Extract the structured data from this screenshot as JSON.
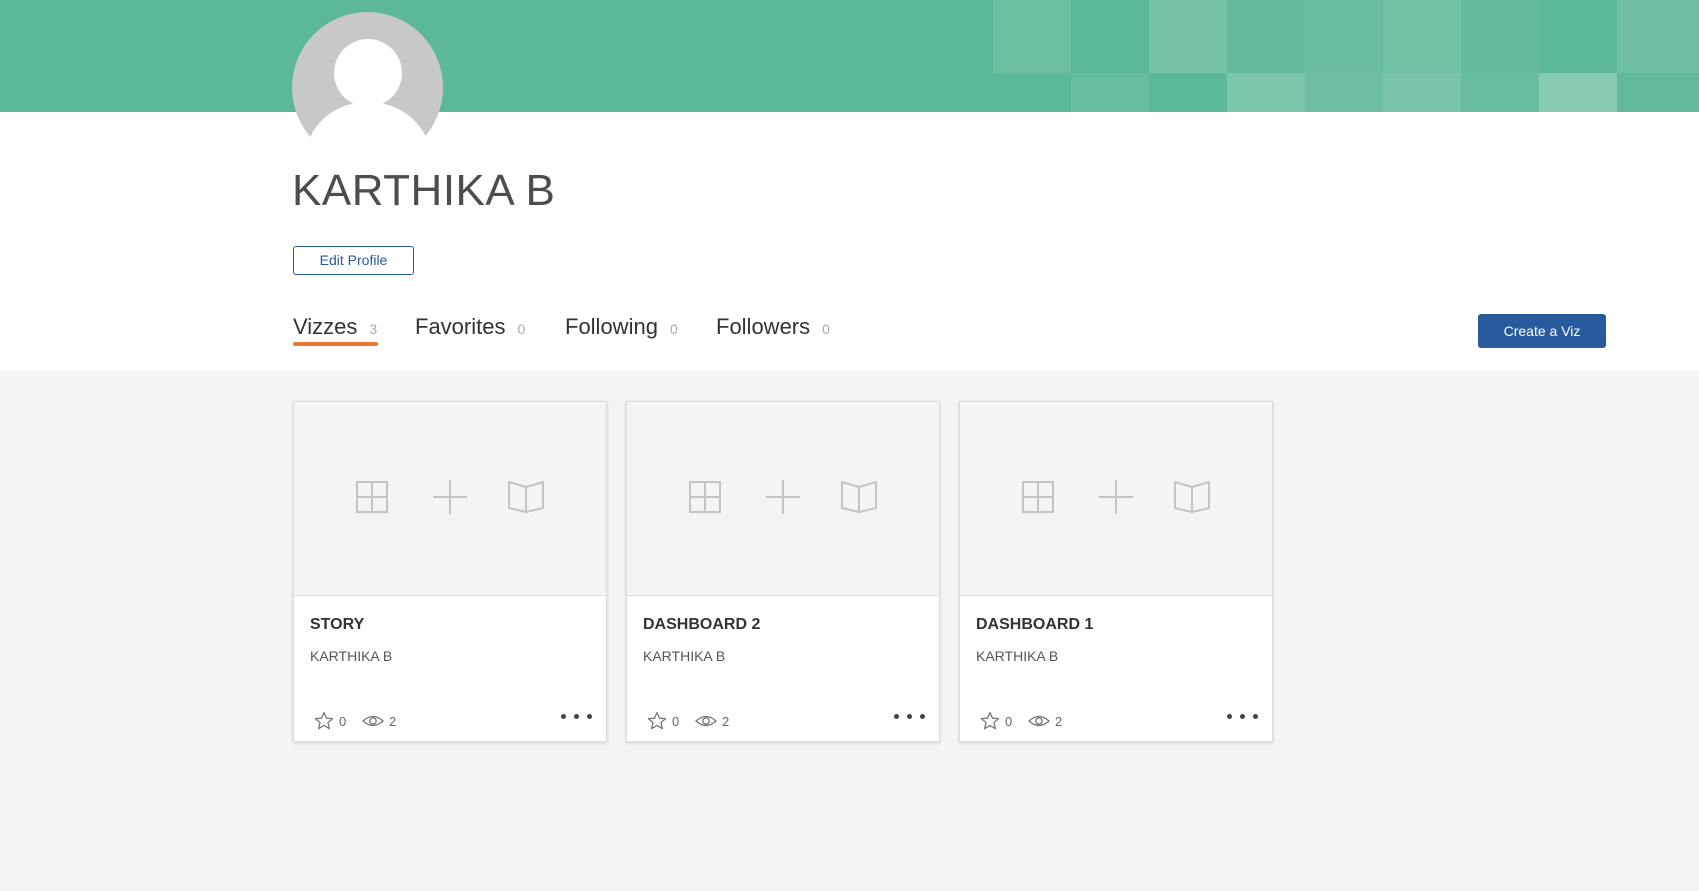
{
  "profile": {
    "name": "KARTHIKA B",
    "edit_label": "Edit Profile"
  },
  "tabs": [
    {
      "label": "Vizzes",
      "count": "3",
      "active": true
    },
    {
      "label": "Favorites",
      "count": "0",
      "active": false
    },
    {
      "label": "Following",
      "count": "0",
      "active": false
    },
    {
      "label": "Followers",
      "count": "0",
      "active": false
    }
  ],
  "actions": {
    "create_viz_label": "Create a Viz"
  },
  "cards": [
    {
      "title": "STORY",
      "author": "KARTHIKA B",
      "favorites": "0",
      "views": "2"
    },
    {
      "title": "DASHBOARD 2",
      "author": "KARTHIKA B",
      "favorites": "0",
      "views": "2"
    },
    {
      "title": "DASHBOARD 1",
      "author": "KARTHIKA B",
      "favorites": "0",
      "views": "2"
    }
  ],
  "icons": {
    "thumbnail": [
      "grid-icon",
      "plus-icon",
      "book-icon"
    ],
    "favorite": "star-icon",
    "views": "eye-icon",
    "more": "more-dots-icon"
  },
  "colors": {
    "banner": "#5bb89a",
    "accent_underline": "#e8762d",
    "primary_button": "#2a5a9e"
  }
}
